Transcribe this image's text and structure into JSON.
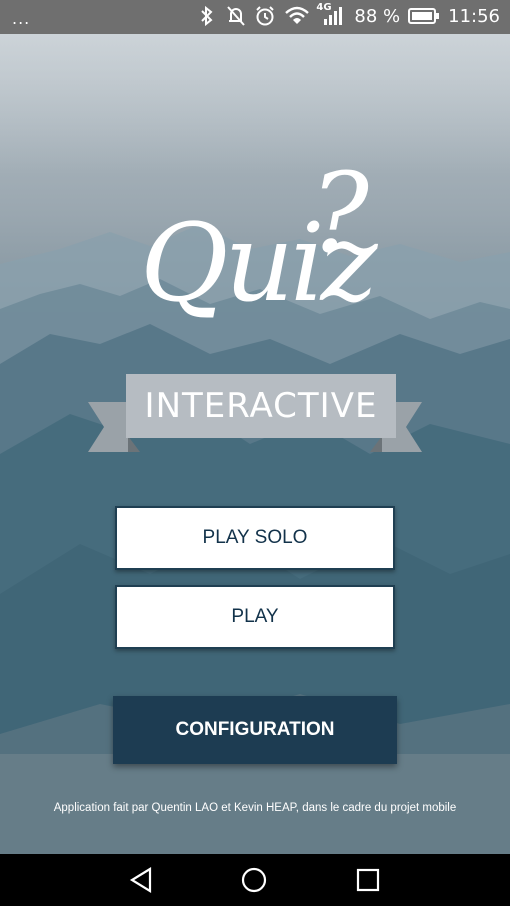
{
  "status_bar": {
    "menu_dots": "...",
    "network_label": "4G",
    "battery_percent": "88 %",
    "time": "11:56",
    "icons": [
      "bluetooth-icon",
      "vibrate-icon",
      "alarm-icon",
      "wifi-icon",
      "signal-icon",
      "battery-icon"
    ]
  },
  "logo": {
    "title": "Quiz",
    "question_mark": "?",
    "subtitle": "INTERACTIVE"
  },
  "buttons": {
    "play_solo": "PLAY SOLO",
    "play": "PLAY",
    "configuration": "CONFIGURATION"
  },
  "footer": {
    "credits": "Application fait par Quentin LAO et Kevin HEAP, dans le cadre du projet mobile"
  },
  "nav_bar": {
    "icons": [
      "back-icon",
      "home-icon",
      "recents-icon"
    ]
  },
  "colors": {
    "primary_dark": "#1d3c52",
    "button_text": "#12324a",
    "ribbon": "#b6bcc2"
  }
}
